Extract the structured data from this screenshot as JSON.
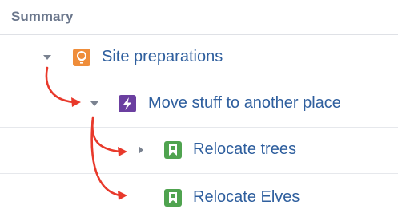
{
  "header": {
    "summary_label": "Summary"
  },
  "rows": [
    {
      "label": "Site preparations",
      "icon": "lightbulb-icon",
      "icon_color": "#ef8d3a",
      "toggle": "expanded"
    },
    {
      "label": "Move stuff to another place",
      "icon": "lightning-icon",
      "icon_color": "#6b3fa0",
      "toggle": "expanded"
    },
    {
      "label": "Relocate trees",
      "icon": "bookmark-icon",
      "icon_color": "#4fa34f",
      "toggle": "collapsed"
    },
    {
      "label": "Relocate Elves",
      "icon": "bookmark-icon",
      "icon_color": "#4fa34f",
      "toggle": "none"
    }
  ],
  "colors": {
    "link": "#2f5f9e",
    "arrow": "#e8392b",
    "header_text": "#6b778c"
  }
}
